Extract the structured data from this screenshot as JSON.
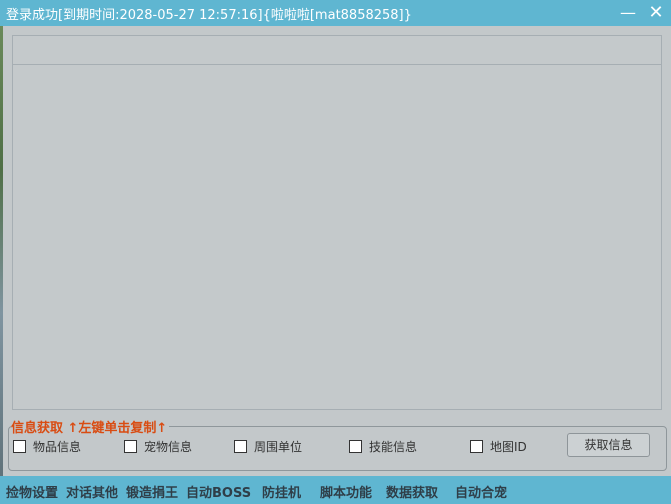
{
  "window": {
    "title": "登录成功[到期时间:2028-05-27 12:57:16]{啦啦啦[mat8858258]}",
    "minimize_glyph": "—",
    "close_glyph": "✕"
  },
  "info_group": {
    "legend": "信息获取 ↑左键单击复制↑",
    "checkboxes": [
      {
        "label": "物品信息",
        "checked": false
      },
      {
        "label": "宠物信息",
        "checked": false
      },
      {
        "label": "周围单位",
        "checked": false
      },
      {
        "label": "技能信息",
        "checked": false
      },
      {
        "label": "地图ID",
        "checked": false
      }
    ],
    "fetch_button": "获取信息"
  },
  "tabs": [
    "捡物设置",
    "对话其他",
    "锻造捐王",
    "自动BOSS",
    "防挂机",
    "脚本功能",
    "数据获取",
    "自动合宠"
  ],
  "colors": {
    "titlebar": "#5fb6d1",
    "background": "#c3c8ca",
    "legend": "#d94c12"
  }
}
